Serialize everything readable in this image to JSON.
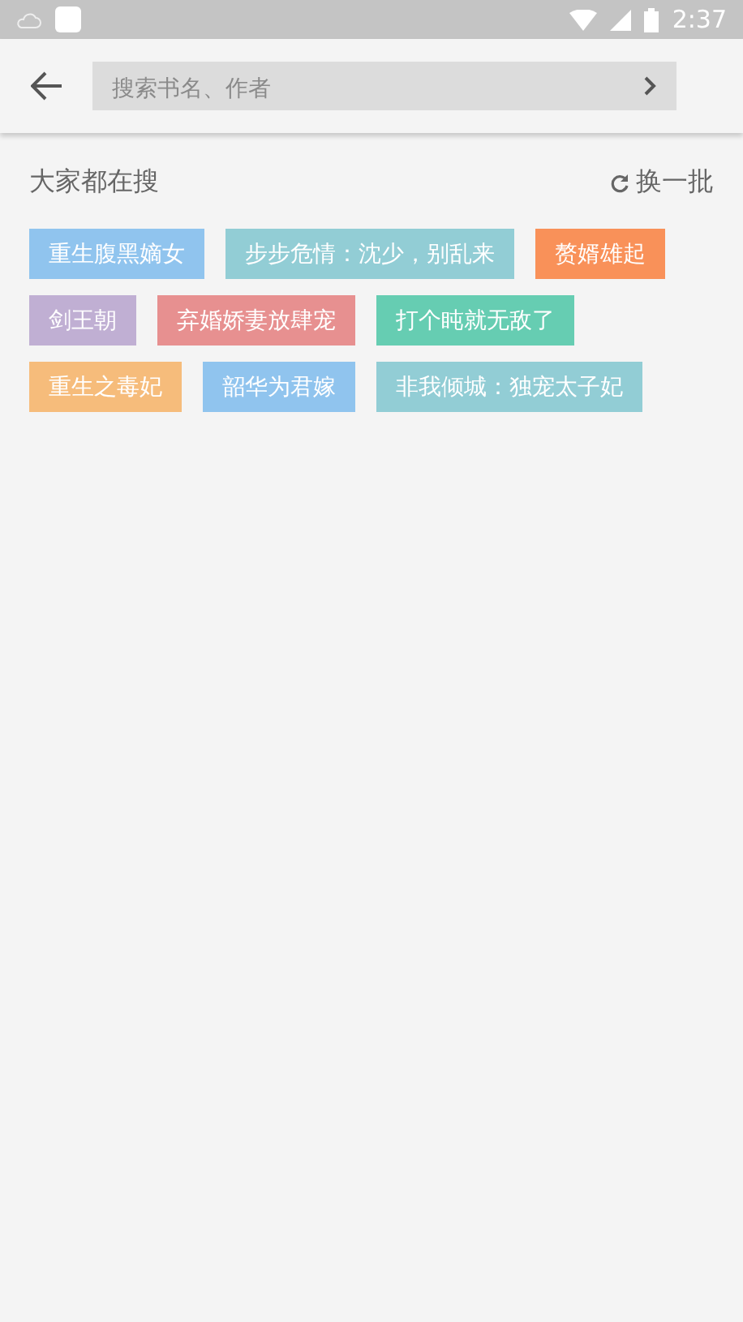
{
  "status_bar": {
    "time": "2:37"
  },
  "search": {
    "placeholder": "搜索书名、作者"
  },
  "hot": {
    "title": "大家都在搜",
    "refresh": "换一批",
    "tags": [
      {
        "label": "重生腹黑嫡女",
        "color": "#90c4ee"
      },
      {
        "label": "步步危情：沈少，别乱来",
        "color": "#92cdd5"
      },
      {
        "label": "赘婿雄起",
        "color": "#f99159"
      },
      {
        "label": "剑王朝",
        "color": "#c0afd3"
      },
      {
        "label": "弃婚娇妻放肆宠",
        "color": "#e79090"
      },
      {
        "label": "打个盹就无敌了",
        "color": "#66cdb2"
      },
      {
        "label": "重生之毒妃",
        "color": "#f6bc7b"
      },
      {
        "label": "韶华为君嫁",
        "color": "#90c4ee"
      },
      {
        "label": "非我倾城：独宠太子妃",
        "color": "#92cdd5"
      }
    ]
  }
}
